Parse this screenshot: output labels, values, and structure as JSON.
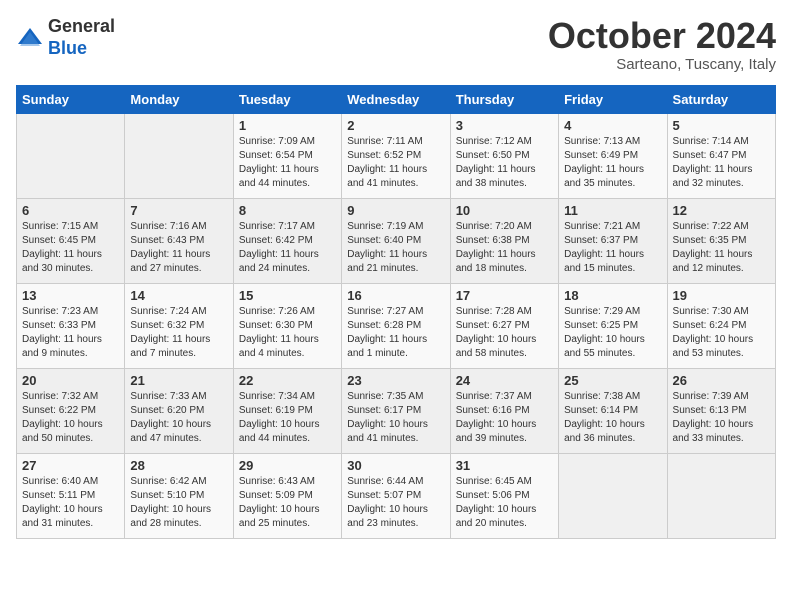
{
  "header": {
    "logo_line1": "General",
    "logo_line2": "Blue",
    "title": "October 2024",
    "subtitle": "Sarteano, Tuscany, Italy"
  },
  "days_of_week": [
    "Sunday",
    "Monday",
    "Tuesday",
    "Wednesday",
    "Thursday",
    "Friday",
    "Saturday"
  ],
  "weeks": [
    [
      {
        "day": "",
        "info": ""
      },
      {
        "day": "",
        "info": ""
      },
      {
        "day": "1",
        "info": "Sunrise: 7:09 AM\nSunset: 6:54 PM\nDaylight: 11 hours and 44 minutes."
      },
      {
        "day": "2",
        "info": "Sunrise: 7:11 AM\nSunset: 6:52 PM\nDaylight: 11 hours and 41 minutes."
      },
      {
        "day": "3",
        "info": "Sunrise: 7:12 AM\nSunset: 6:50 PM\nDaylight: 11 hours and 38 minutes."
      },
      {
        "day": "4",
        "info": "Sunrise: 7:13 AM\nSunset: 6:49 PM\nDaylight: 11 hours and 35 minutes."
      },
      {
        "day": "5",
        "info": "Sunrise: 7:14 AM\nSunset: 6:47 PM\nDaylight: 11 hours and 32 minutes."
      }
    ],
    [
      {
        "day": "6",
        "info": "Sunrise: 7:15 AM\nSunset: 6:45 PM\nDaylight: 11 hours and 30 minutes."
      },
      {
        "day": "7",
        "info": "Sunrise: 7:16 AM\nSunset: 6:43 PM\nDaylight: 11 hours and 27 minutes."
      },
      {
        "day": "8",
        "info": "Sunrise: 7:17 AM\nSunset: 6:42 PM\nDaylight: 11 hours and 24 minutes."
      },
      {
        "day": "9",
        "info": "Sunrise: 7:19 AM\nSunset: 6:40 PM\nDaylight: 11 hours and 21 minutes."
      },
      {
        "day": "10",
        "info": "Sunrise: 7:20 AM\nSunset: 6:38 PM\nDaylight: 11 hours and 18 minutes."
      },
      {
        "day": "11",
        "info": "Sunrise: 7:21 AM\nSunset: 6:37 PM\nDaylight: 11 hours and 15 minutes."
      },
      {
        "day": "12",
        "info": "Sunrise: 7:22 AM\nSunset: 6:35 PM\nDaylight: 11 hours and 12 minutes."
      }
    ],
    [
      {
        "day": "13",
        "info": "Sunrise: 7:23 AM\nSunset: 6:33 PM\nDaylight: 11 hours and 9 minutes."
      },
      {
        "day": "14",
        "info": "Sunrise: 7:24 AM\nSunset: 6:32 PM\nDaylight: 11 hours and 7 minutes."
      },
      {
        "day": "15",
        "info": "Sunrise: 7:26 AM\nSunset: 6:30 PM\nDaylight: 11 hours and 4 minutes."
      },
      {
        "day": "16",
        "info": "Sunrise: 7:27 AM\nSunset: 6:28 PM\nDaylight: 11 hours and 1 minute."
      },
      {
        "day": "17",
        "info": "Sunrise: 7:28 AM\nSunset: 6:27 PM\nDaylight: 10 hours and 58 minutes."
      },
      {
        "day": "18",
        "info": "Sunrise: 7:29 AM\nSunset: 6:25 PM\nDaylight: 10 hours and 55 minutes."
      },
      {
        "day": "19",
        "info": "Sunrise: 7:30 AM\nSunset: 6:24 PM\nDaylight: 10 hours and 53 minutes."
      }
    ],
    [
      {
        "day": "20",
        "info": "Sunrise: 7:32 AM\nSunset: 6:22 PM\nDaylight: 10 hours and 50 minutes."
      },
      {
        "day": "21",
        "info": "Sunrise: 7:33 AM\nSunset: 6:20 PM\nDaylight: 10 hours and 47 minutes."
      },
      {
        "day": "22",
        "info": "Sunrise: 7:34 AM\nSunset: 6:19 PM\nDaylight: 10 hours and 44 minutes."
      },
      {
        "day": "23",
        "info": "Sunrise: 7:35 AM\nSunset: 6:17 PM\nDaylight: 10 hours and 41 minutes."
      },
      {
        "day": "24",
        "info": "Sunrise: 7:37 AM\nSunset: 6:16 PM\nDaylight: 10 hours and 39 minutes."
      },
      {
        "day": "25",
        "info": "Sunrise: 7:38 AM\nSunset: 6:14 PM\nDaylight: 10 hours and 36 minutes."
      },
      {
        "day": "26",
        "info": "Sunrise: 7:39 AM\nSunset: 6:13 PM\nDaylight: 10 hours and 33 minutes."
      }
    ],
    [
      {
        "day": "27",
        "info": "Sunrise: 6:40 AM\nSunset: 5:11 PM\nDaylight: 10 hours and 31 minutes."
      },
      {
        "day": "28",
        "info": "Sunrise: 6:42 AM\nSunset: 5:10 PM\nDaylight: 10 hours and 28 minutes."
      },
      {
        "day": "29",
        "info": "Sunrise: 6:43 AM\nSunset: 5:09 PM\nDaylight: 10 hours and 25 minutes."
      },
      {
        "day": "30",
        "info": "Sunrise: 6:44 AM\nSunset: 5:07 PM\nDaylight: 10 hours and 23 minutes."
      },
      {
        "day": "31",
        "info": "Sunrise: 6:45 AM\nSunset: 5:06 PM\nDaylight: 10 hours and 20 minutes."
      },
      {
        "day": "",
        "info": ""
      },
      {
        "day": "",
        "info": ""
      }
    ]
  ]
}
